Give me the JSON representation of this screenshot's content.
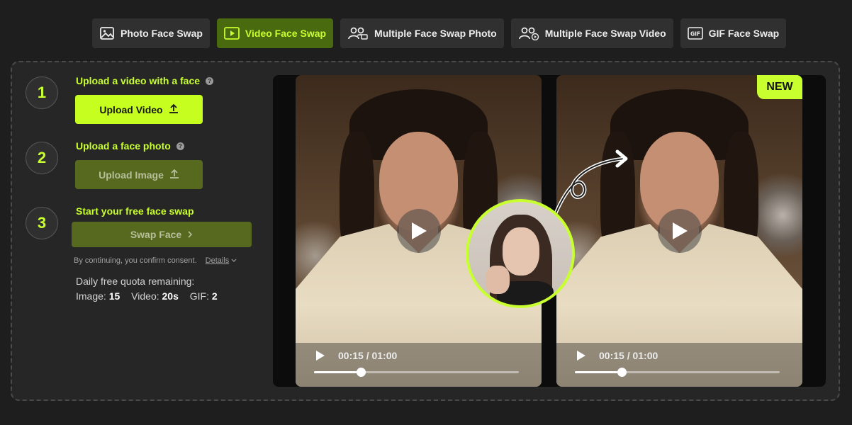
{
  "tabs": [
    {
      "label": "Photo Face Swap",
      "icon": "image-icon",
      "active": false
    },
    {
      "label": "Video Face Swap",
      "icon": "video-icon",
      "active": true
    },
    {
      "label": "Multiple Face Swap Photo",
      "icon": "group-image-icon",
      "active": false
    },
    {
      "label": "Multiple Face Swap Video",
      "icon": "group-video-icon",
      "active": false
    },
    {
      "label": "GIF Face Swap",
      "icon": "gif-icon",
      "active": false
    }
  ],
  "steps": [
    {
      "number": "1",
      "title": "Upload a video with a face",
      "button": "Upload Video"
    },
    {
      "number": "2",
      "title": "Upload a face photo",
      "button": "Upload Image"
    },
    {
      "number": "3",
      "title": "Start your free face swap",
      "button": "Swap Face"
    }
  ],
  "consent": {
    "text": "By continuing, you confirm consent.",
    "details": "Details"
  },
  "quota": {
    "heading": "Daily free quota remaining:",
    "image_label": "Image:",
    "image_value": "15",
    "video_label": "Video:",
    "video_value": "20s",
    "gif_label": "GIF:",
    "gif_value": "2"
  },
  "preview": {
    "badge": "NEW",
    "original_time": "00:15 / 01:00",
    "result_time": "00:15 / 01:00",
    "progress": 0.23
  },
  "colors": {
    "accent": "#c8ff2e",
    "accent_dim": "#56691f",
    "background": "#1e1e1e",
    "panel": "#262626"
  }
}
